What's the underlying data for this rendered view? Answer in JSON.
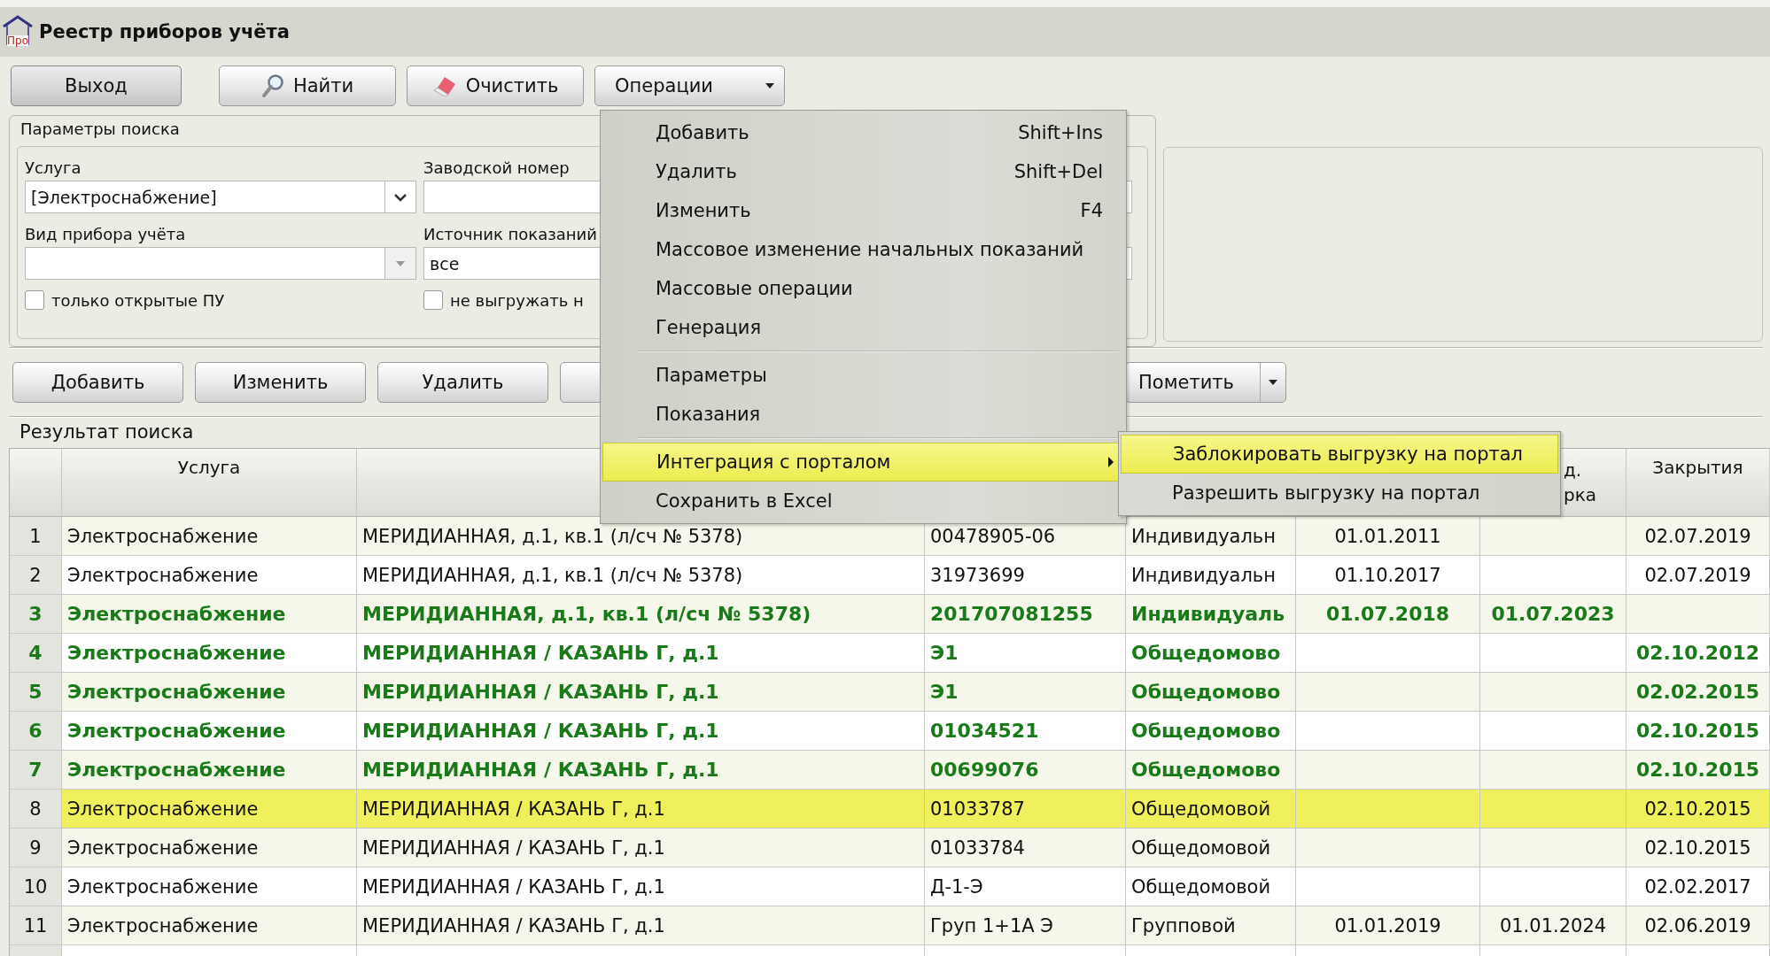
{
  "window": {
    "title": "Реестр приборов учёта",
    "logo_text": "Про"
  },
  "toolbar": [
    {
      "label": "Выход",
      "default": true
    },
    {
      "label": "Найти",
      "default": false
    },
    {
      "label": "Очистить",
      "default": false
    },
    {
      "label": "Операции",
      "default": false
    }
  ],
  "search_params": {
    "title": "Параметры поиска",
    "fields": [
      {
        "label": "Услуга",
        "value": "[Электроснабжение]",
        "kind": "combo",
        "disabled": false
      },
      {
        "label": "Заводской номер",
        "kind": "text"
      },
      {
        "label": "Вид прибора учёта",
        "kind": "combo",
        "disabled": true
      },
      {
        "label": "Источник показаний",
        "value": "все",
        "kind": "text"
      }
    ],
    "checkboxes": [
      {
        "label": "только открытые ПУ",
        "checked": false
      },
      {
        "label": "не выгружать н",
        "checked": false
      }
    ]
  },
  "actions": [
    {
      "label": "Добавить",
      "kind": "button"
    },
    {
      "label": "Изменить",
      "kind": "button"
    },
    {
      "label": "Удалить",
      "kind": "button"
    },
    {
      "kind": "hidden"
    },
    {
      "label": "Пометить",
      "kind": "split"
    }
  ],
  "results": {
    "title": "Результат поиска",
    "columns": [
      null,
      "Услуга",
      null,
      null,
      null,
      null,
      "д.\nрка",
      "Закрытия"
    ],
    "rows": [
      {
        "cells": [
          "1",
          "Электроснабжение",
          "МЕРИДИАННАЯ, д.1, кв.1 (л/сч № 5378)",
          "00478905-06",
          "Индивидуальн",
          "01.01.2011",
          "",
          "02.07.2019"
        ],
        "bold": false,
        "selected": false
      },
      {
        "cells": [
          "2",
          "Электроснабжение",
          "МЕРИДИАННАЯ, д.1, кв.1 (л/сч № 5378)",
          "31973699",
          "Индивидуальн",
          "01.10.2017",
          "",
          "02.07.2019"
        ],
        "bold": false,
        "selected": false
      },
      {
        "cells": [
          "3",
          "Электроснабжение",
          "МЕРИДИАННАЯ, д.1, кв.1 (л/сч № 5378)",
          "201707081255",
          "Индивидуаль",
          "01.07.2018",
          "01.07.2023",
          ""
        ],
        "bold": true,
        "selected": false
      },
      {
        "cells": [
          "4",
          "Электроснабжение",
          "МЕРИДИАННАЯ / КАЗАНЬ Г, д.1",
          "Э1",
          "Общедомово",
          "",
          "",
          "02.10.2012"
        ],
        "bold": true,
        "selected": false
      },
      {
        "cells": [
          "5",
          "Электроснабжение",
          "МЕРИДИАННАЯ / КАЗАНЬ Г, д.1",
          "Э1",
          "Общедомово",
          "",
          "",
          "02.02.2015"
        ],
        "bold": true,
        "selected": false
      },
      {
        "cells": [
          "6",
          "Электроснабжение",
          "МЕРИДИАННАЯ / КАЗАНЬ Г, д.1",
          "01034521",
          "Общедомово",
          "",
          "",
          "02.10.2015"
        ],
        "bold": true,
        "selected": false
      },
      {
        "cells": [
          "7",
          "Электроснабжение",
          "МЕРИДИАННАЯ / КАЗАНЬ Г, д.1",
          "00699076",
          "Общедомово",
          "",
          "",
          "02.10.2015"
        ],
        "bold": true,
        "selected": false
      },
      {
        "cells": [
          "8",
          "Электроснабжение",
          "МЕРИДИАННАЯ / КАЗАНЬ Г, д.1",
          "01033787",
          "Общедомовой",
          "",
          "",
          "02.10.2015"
        ],
        "bold": false,
        "selected": true
      },
      {
        "cells": [
          "9",
          "Электроснабжение",
          "МЕРИДИАННАЯ / КАЗАНЬ Г, д.1",
          "01033784",
          "Общедомовой",
          "",
          "",
          "02.10.2015"
        ],
        "bold": false,
        "selected": false
      },
      {
        "cells": [
          "10",
          "Электроснабжение",
          "МЕРИДИАННАЯ / КАЗАНЬ Г, д.1",
          "Д-1-Э",
          "Общедомовой",
          "",
          "",
          "02.02.2017"
        ],
        "bold": false,
        "selected": false
      },
      {
        "cells": [
          "11",
          "Электроснабжение",
          "МЕРИДИАННАЯ / КАЗАНЬ Г, д.1",
          "Груп 1+1А Э",
          "Групповой",
          "01.01.2019",
          "01.01.2024",
          "02.06.2019"
        ],
        "bold": false,
        "selected": false
      }
    ]
  },
  "menu": {
    "items": [
      {
        "kind": "item",
        "label": "Добавить",
        "shortcut": "Shift+Ins",
        "selected": false
      },
      {
        "kind": "item",
        "label": "Удалить",
        "shortcut": "Shift+Del",
        "selected": false
      },
      {
        "kind": "item",
        "label": "Изменить",
        "shortcut": "F4",
        "selected": false
      },
      {
        "kind": "item",
        "label": "Массовое изменение начальных показаний",
        "selected": false
      },
      {
        "kind": "item",
        "label": "Массовые операции",
        "selected": false
      },
      {
        "kind": "item",
        "label": "Генерация",
        "selected": false
      },
      {
        "kind": "separator"
      },
      {
        "kind": "item",
        "label": "Параметры",
        "selected": false
      },
      {
        "kind": "item",
        "label": "Показания",
        "selected": false
      },
      {
        "kind": "separator"
      },
      {
        "kind": "submenu",
        "label": "Интеграция с порталом",
        "selected": true
      },
      {
        "kind": "item",
        "label": "Сохранить в Excel",
        "selected": false
      }
    ],
    "submenu": [
      {
        "label": "Заблокировать выгрузку на портал",
        "selected": true
      },
      {
        "label": "Разрешить выгрузку на портал",
        "selected": false
      }
    ]
  }
}
